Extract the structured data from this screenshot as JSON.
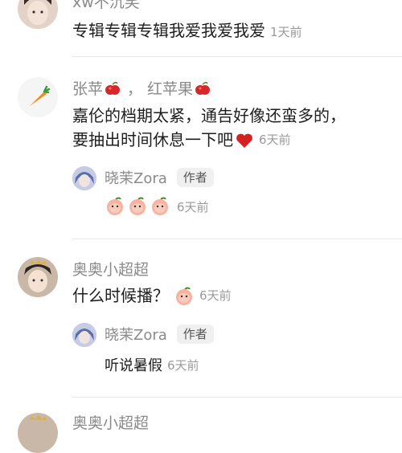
{
  "comments": [
    {
      "name": "xw不沉笑",
      "text": "专辑专辑专辑我爱我爱我爱",
      "time": "1天前"
    },
    {
      "name_part1": "张苹",
      "name_sep": "，",
      "name_part2": "红苹果",
      "text_line1": "嘉伦的档期太紧，通告好像还蛮多的，",
      "text_line2": "要抽出时间休息一下吧",
      "time": "6天前",
      "reply": {
        "name": "晓茉Zora",
        "tag": "作者",
        "time": "6天前"
      }
    },
    {
      "name": "奥奥小超超",
      "text": "什么时候播？",
      "time": "6天前",
      "reply": {
        "name": "晓茉Zora",
        "tag": "作者",
        "text": "听说暑假",
        "time": "6天前"
      }
    },
    {
      "name": "奥奥小超超"
    }
  ]
}
